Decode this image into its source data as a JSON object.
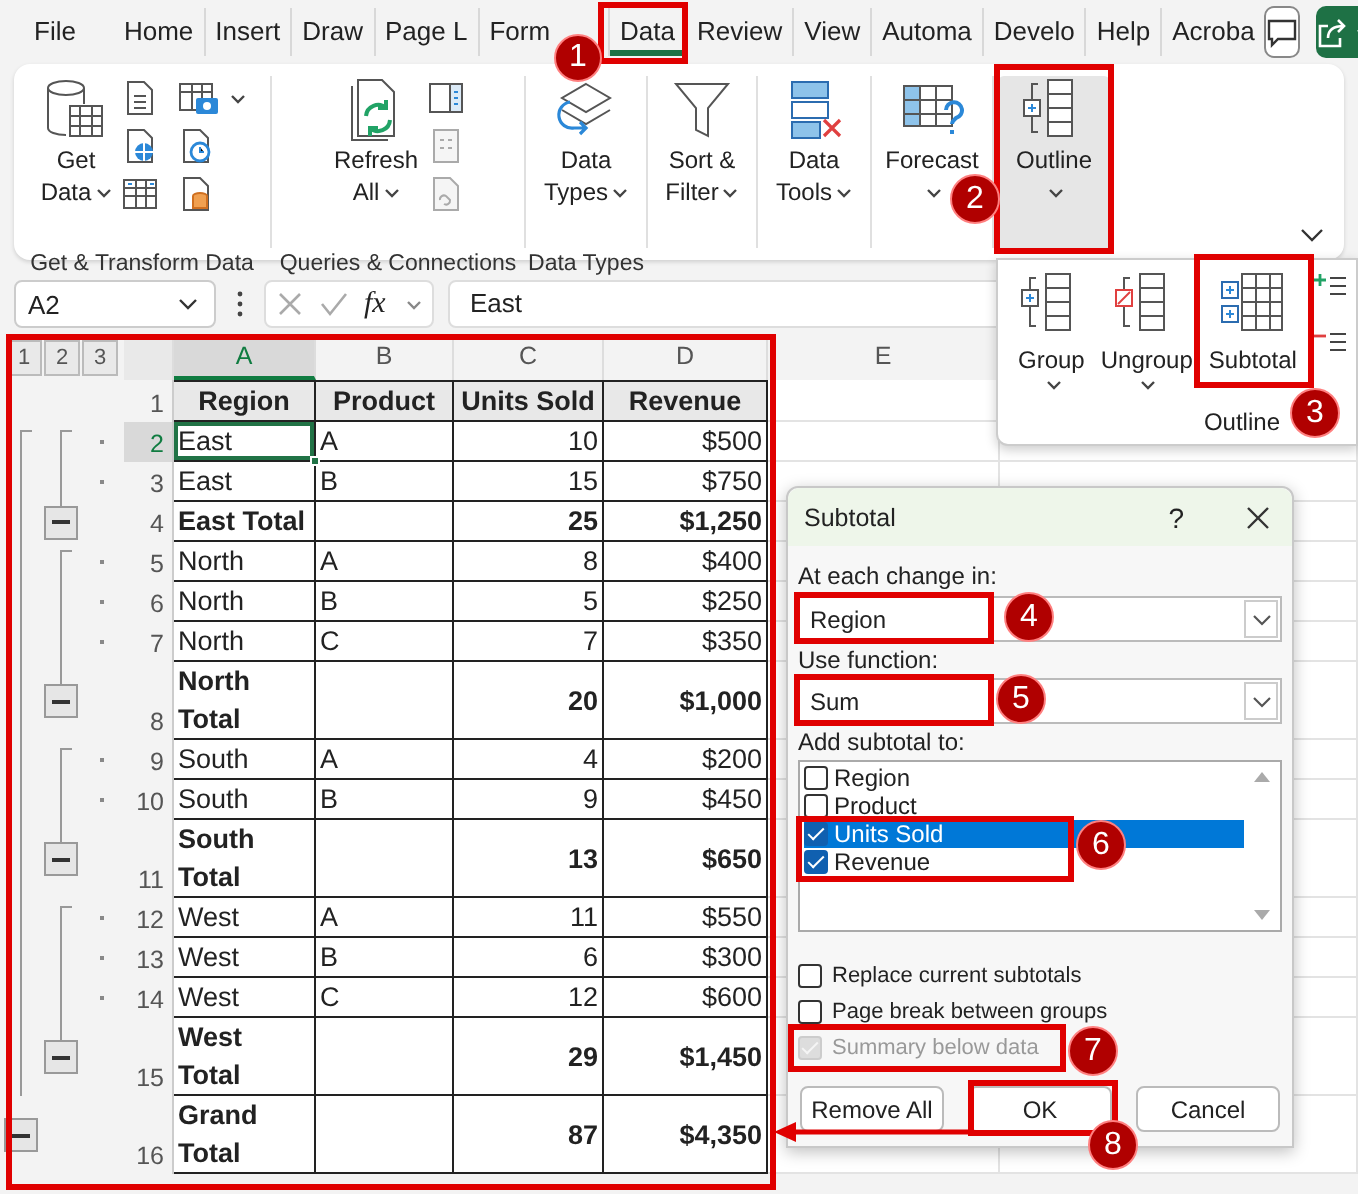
{
  "tabs": [
    {
      "label": "File",
      "selected": false
    },
    {
      "label": "Home",
      "selected": false
    },
    {
      "label": "Insert",
      "selected": false
    },
    {
      "label": "Draw",
      "selected": false
    },
    {
      "label": "Page L",
      "selected": false
    },
    {
      "label": "Form",
      "selected": false
    },
    {
      "label": "Data",
      "selected": true
    },
    {
      "label": "Review",
      "selected": false
    },
    {
      "label": "View",
      "selected": false
    },
    {
      "label": "Automa",
      "selected": false
    },
    {
      "label": "Develo",
      "selected": false
    },
    {
      "label": "Help",
      "selected": false
    },
    {
      "label": "Acroba",
      "selected": false
    }
  ],
  "ribbon": {
    "groups": [
      {
        "label": "Get & Transform Data",
        "buttons": [
          {
            "lines": [
              "Get",
              "Data"
            ],
            "dropdown": true,
            "selected": false
          }
        ]
      },
      {
        "label": "Queries & Connections",
        "buttons": [
          {
            "lines": [
              "Refresh",
              "All"
            ],
            "dropdown": true,
            "selected": false
          }
        ]
      },
      {
        "label": "Data Types",
        "buttons": [
          {
            "lines": [
              "Data",
              "Types"
            ],
            "dropdown": true,
            "selected": false
          }
        ]
      },
      {
        "buttons": [
          {
            "lines": [
              "Sort &",
              "Filter"
            ],
            "dropdown": true,
            "selected": false
          }
        ]
      },
      {
        "buttons": [
          {
            "lines": [
              "Data",
              "Tools"
            ],
            "dropdown": true,
            "selected": false
          }
        ]
      },
      {
        "buttons": [
          {
            "lines": [
              "Forecast"
            ],
            "dropdown": true,
            "selected": false
          }
        ]
      },
      {
        "buttons": [
          {
            "lines": [
              "Outline"
            ],
            "dropdown": true,
            "selected": true
          }
        ]
      }
    ]
  },
  "formula_bar": {
    "name_box": "A2",
    "fx_label": "fx",
    "value": "East"
  },
  "sheet": {
    "outline_levels": [
      "1",
      "2",
      "3"
    ],
    "columns": [
      {
        "label": "A",
        "selected": true
      },
      {
        "label": "B",
        "selected": false
      },
      {
        "label": "C",
        "selected": false
      },
      {
        "label": "D",
        "selected": false
      },
      {
        "label": "E",
        "selected": false
      }
    ],
    "rows": [
      {
        "number": "1",
        "kind": "header",
        "selected": false,
        "region": "Region",
        "product": "Product",
        "units": "Units Sold",
        "revenue": "Revenue"
      },
      {
        "number": "2",
        "kind": "detail",
        "selected": true,
        "region": "East",
        "product": "A",
        "units": "10",
        "revenue": "$500"
      },
      {
        "number": "3",
        "kind": "detail",
        "selected": false,
        "region": "East",
        "product": "B",
        "units": "15",
        "revenue": "$750"
      },
      {
        "number": "4",
        "kind": "subtotal",
        "selected": false,
        "region": "East Total",
        "units": "25",
        "revenue": "$1,250"
      },
      {
        "number": "5",
        "kind": "detail",
        "selected": false,
        "region": "North",
        "product": "A",
        "units": "8",
        "revenue": "$400"
      },
      {
        "number": "6",
        "kind": "detail",
        "selected": false,
        "region": "North",
        "product": "B",
        "units": "5",
        "revenue": "$250"
      },
      {
        "number": "7",
        "kind": "detail",
        "selected": false,
        "region": "North",
        "product": "C",
        "units": "7",
        "revenue": "$350"
      },
      {
        "number": "8",
        "kind": "subtotal",
        "selected": false,
        "region": "North Total",
        "units": "20",
        "revenue": "$1,000"
      },
      {
        "number": "9",
        "kind": "detail",
        "selected": false,
        "region": "South",
        "product": "A",
        "units": "4",
        "revenue": "$200"
      },
      {
        "number": "10",
        "kind": "detail",
        "selected": false,
        "region": "South",
        "product": "B",
        "units": "9",
        "revenue": "$450"
      },
      {
        "number": "11",
        "kind": "subtotal",
        "selected": false,
        "region": "South Total",
        "units": "13",
        "revenue": "$650"
      },
      {
        "number": "12",
        "kind": "detail",
        "selected": false,
        "region": "West",
        "product": "A",
        "units": "11",
        "revenue": "$550"
      },
      {
        "number": "13",
        "kind": "detail",
        "selected": false,
        "region": "West",
        "product": "B",
        "units": "6",
        "revenue": "$300"
      },
      {
        "number": "14",
        "kind": "detail",
        "selected": false,
        "region": "West",
        "product": "C",
        "units": "12",
        "revenue": "$600"
      },
      {
        "number": "15",
        "kind": "subtotal",
        "selected": false,
        "region": "West Total",
        "units": "29",
        "revenue": "$1,450"
      },
      {
        "number": "16",
        "kind": "grand",
        "selected": false,
        "region": "Grand Total",
        "units": "87",
        "revenue": "$4,350"
      }
    ]
  },
  "outline_menu": {
    "items": [
      {
        "label": "Group",
        "dropdown": true
      },
      {
        "label": "Ungroup",
        "dropdown": true
      },
      {
        "label": "Subtotal",
        "dropdown": false
      }
    ],
    "label": "Outline"
  },
  "dialog": {
    "title": "Subtotal",
    "help": "?",
    "change_label": "At each change in:",
    "change_value": "Region",
    "function_label": "Use function:",
    "function_value": "Sum",
    "add_label": "Add subtotal to:",
    "add_items": [
      {
        "label": "Region",
        "checked": false,
        "selected": false
      },
      {
        "label": "Product",
        "checked": false,
        "selected": false
      },
      {
        "label": "Units Sold",
        "checked": true,
        "selected": true
      },
      {
        "label": "Revenue",
        "checked": true,
        "selected": false
      }
    ],
    "options": [
      {
        "label": "Replace current subtotals",
        "checked": false,
        "disabled": false
      },
      {
        "label": "Page break between groups",
        "checked": false,
        "disabled": false
      },
      {
        "label": "Summary below data",
        "checked": true,
        "disabled": true
      }
    ],
    "buttons": [
      "Remove All",
      "OK",
      "Cancel"
    ]
  },
  "callouts": [
    {
      "number": "1"
    },
    {
      "number": "2"
    },
    {
      "number": "3"
    },
    {
      "number": "4"
    },
    {
      "number": "5"
    },
    {
      "number": "6"
    },
    {
      "number": "7"
    },
    {
      "number": "8"
    }
  ]
}
